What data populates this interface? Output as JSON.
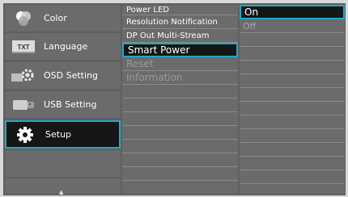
{
  "main_menu": [
    {
      "label": "Color",
      "icon": "color-wheel-icon"
    },
    {
      "label": "Language",
      "icon": "txt-language-icon"
    },
    {
      "label": "OSD Setting",
      "icon": "osd-settings-icon"
    },
    {
      "label": "USB Setting",
      "icon": "usb-icon"
    },
    {
      "label": "Setup",
      "icon": "gear-icon"
    }
  ],
  "scroll_up_glyph": "▲",
  "submenu": [
    "Power LED",
    "Resolution Notification",
    "DP Out Multi-Stream",
    "Smart Power",
    "Reset",
    "Information"
  ],
  "options": [
    "On",
    "Off"
  ],
  "colors": {
    "highlight": "#1fa9c9",
    "selected_bg": "#161616",
    "panel": "#6b6b6b"
  }
}
